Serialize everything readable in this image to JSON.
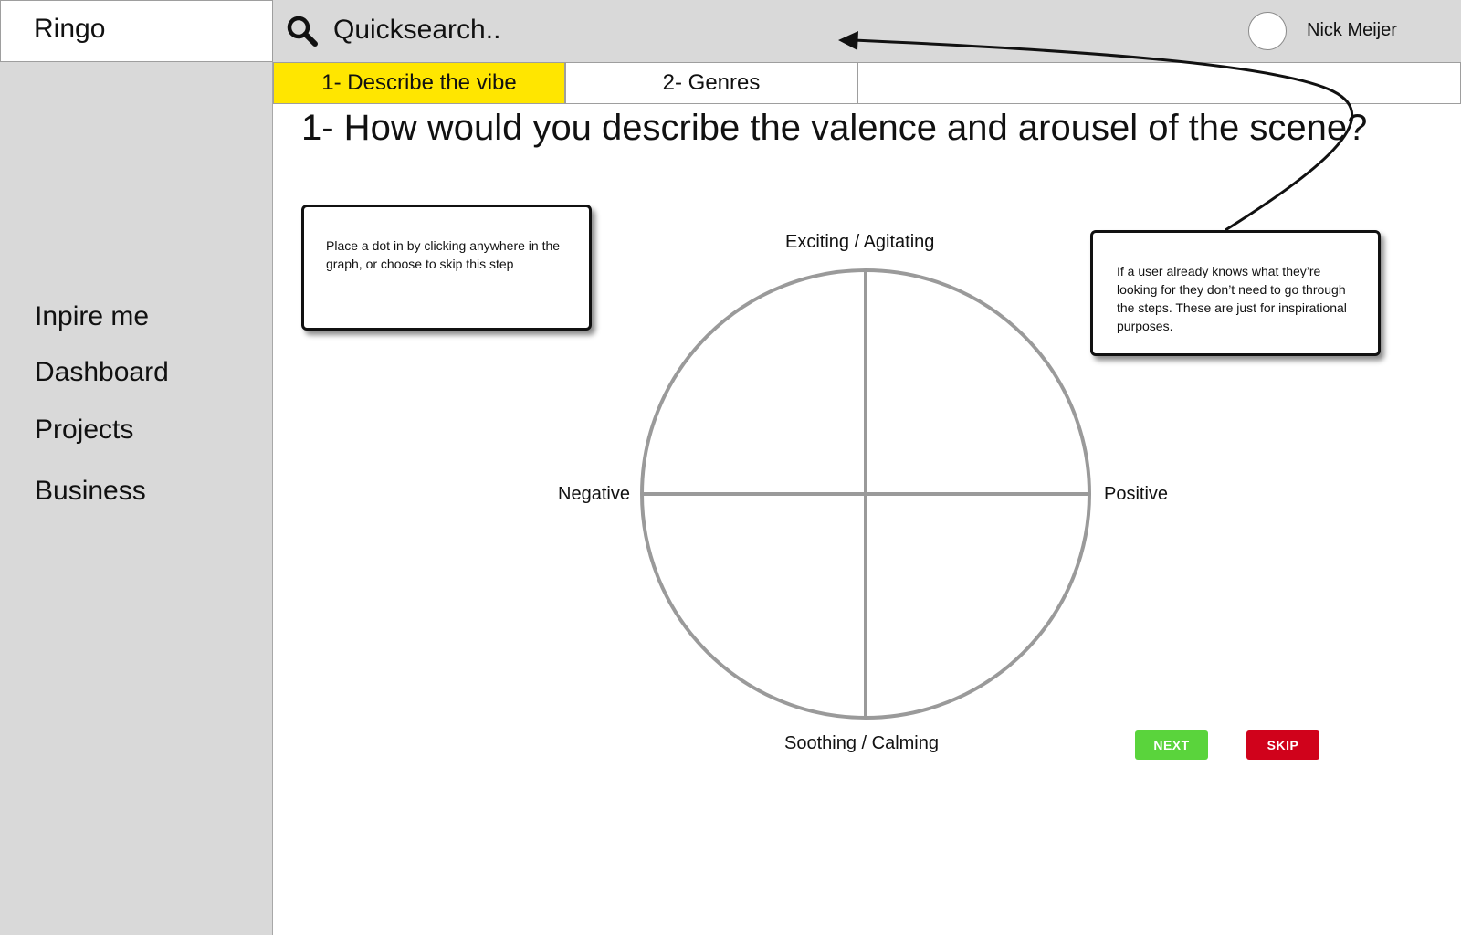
{
  "app": {
    "brand": "Ringo"
  },
  "sidebar": {
    "items": [
      {
        "label": "Inpire me"
      },
      {
        "label": "Dashboard"
      },
      {
        "label": "Projects"
      },
      {
        "label": "Business"
      }
    ]
  },
  "header": {
    "search_placeholder": "Quicksearch..",
    "user_name": "Nick Meijer"
  },
  "tabs": [
    {
      "label": "1- Describe the vibe",
      "active": true
    },
    {
      "label": "2- Genres",
      "active": false
    },
    {
      "label": "",
      "active": false
    }
  ],
  "main": {
    "question": "1- How would you describe the valence and arousel of the scene?",
    "note_left": "Place a dot in by clicking anywhere in the graph, or choose to skip this step",
    "note_right": "If a user already knows what they’re looking for they don’t need to go through the steps. These are just for inspirational purposes.",
    "axis": {
      "top": "Exciting / Agitating",
      "bottom": "Soothing / Calming",
      "left": "Negative",
      "right": "Positive"
    },
    "buttons": {
      "next": "NEXT",
      "skip": "SKIP"
    }
  },
  "colors": {
    "active_tab": "#ffe600",
    "next_button": "#5ad43c",
    "skip_button": "#d0021b",
    "sidebar_bg": "#d9d9d9"
  },
  "icons": [
    "search-icon",
    "avatar",
    "arrow-annotation"
  ]
}
